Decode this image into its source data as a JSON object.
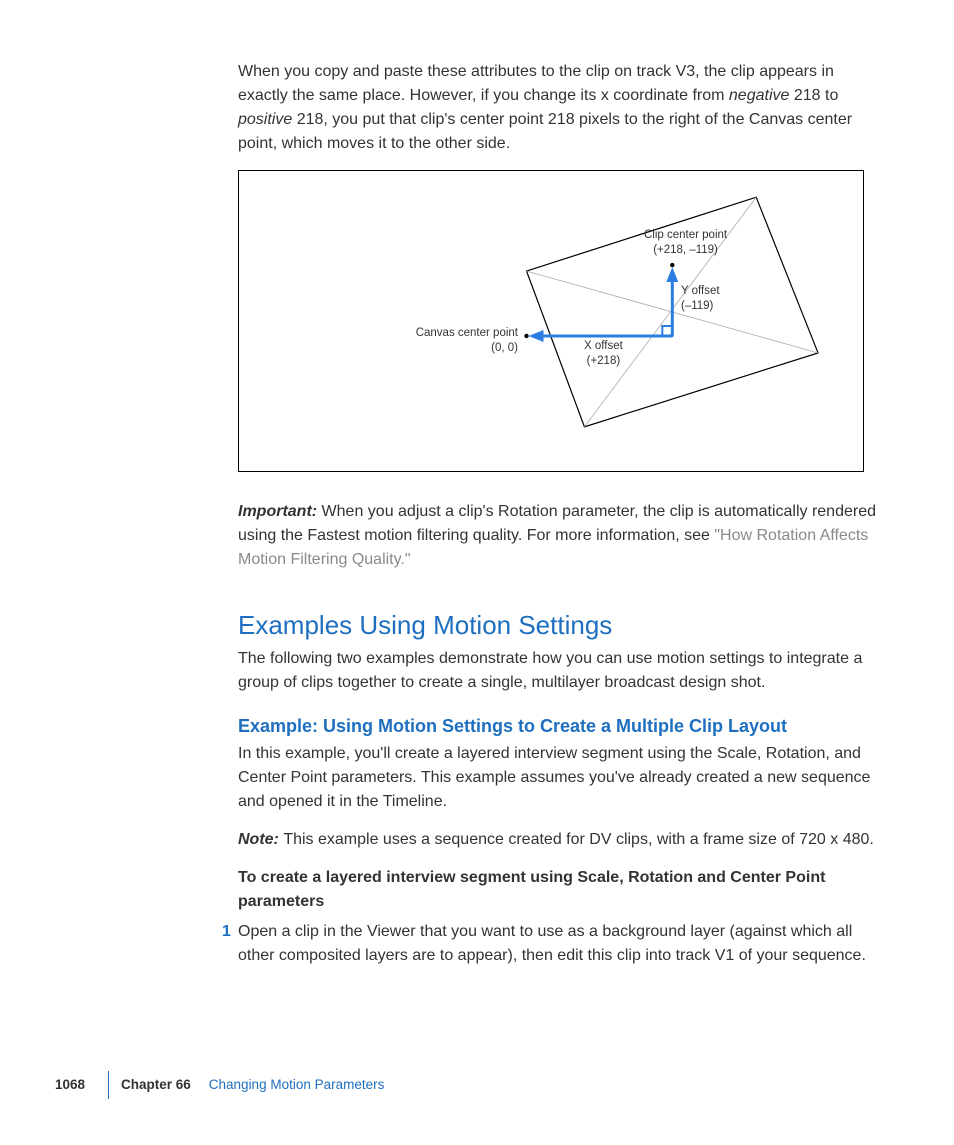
{
  "intro": {
    "p1a": "When you copy and paste these attributes to the clip on track V3, the clip appears in exactly the same place. However, if you change its x coordinate from ",
    "p1_neg": "negative",
    "p1b": " 218 to ",
    "p1_pos": "positive",
    "p1c": " 218, you put that clip's center point 218 pixels to the right of the Canvas center point, which moves it to the other side."
  },
  "diagram": {
    "clip_center_label": "Clip center point",
    "clip_center_value": "(+218, –119)",
    "y_offset_label": "Y offset",
    "y_offset_value": "(–119)",
    "x_offset_label": "X offset",
    "x_offset_value": "(+218)",
    "canvas_center_label": "Canvas center point",
    "canvas_center_value": "(0, 0)"
  },
  "important": {
    "label": "Important:  ",
    "text": "When you adjust a clip's Rotation parameter, the clip is automatically rendered using the Fastest motion filtering quality. For more information, see ",
    "link": "\"How Rotation Affects Motion Filtering Quality.\""
  },
  "section": {
    "h1": "Examples Using Motion Settings",
    "p1": "The following two examples demonstrate how you can use motion settings to integrate a group of clips together to create a single, multilayer broadcast design shot.",
    "h2": "Example: Using Motion Settings to Create a Multiple Clip Layout",
    "p2": "In this example, you'll create a layered interview segment using the Scale, Rotation, and Center Point parameters. This example assumes you've already created a new sequence and opened it in the Timeline.",
    "note_label": "Note:  ",
    "note_text": "This example uses a sequence created for DV clips, with a frame size of 720 x 480.",
    "bold_p": "To create a layered interview segment using Scale, Rotation and Center Point parameters",
    "step_num": "1",
    "step_text": "Open a clip in the Viewer that you want to use as a background layer (against which all other composited layers are to appear), then edit this clip into track V1 of your sequence."
  },
  "footer": {
    "page": "1068",
    "chapter": "Chapter 66",
    "title": "Changing Motion Parameters"
  }
}
